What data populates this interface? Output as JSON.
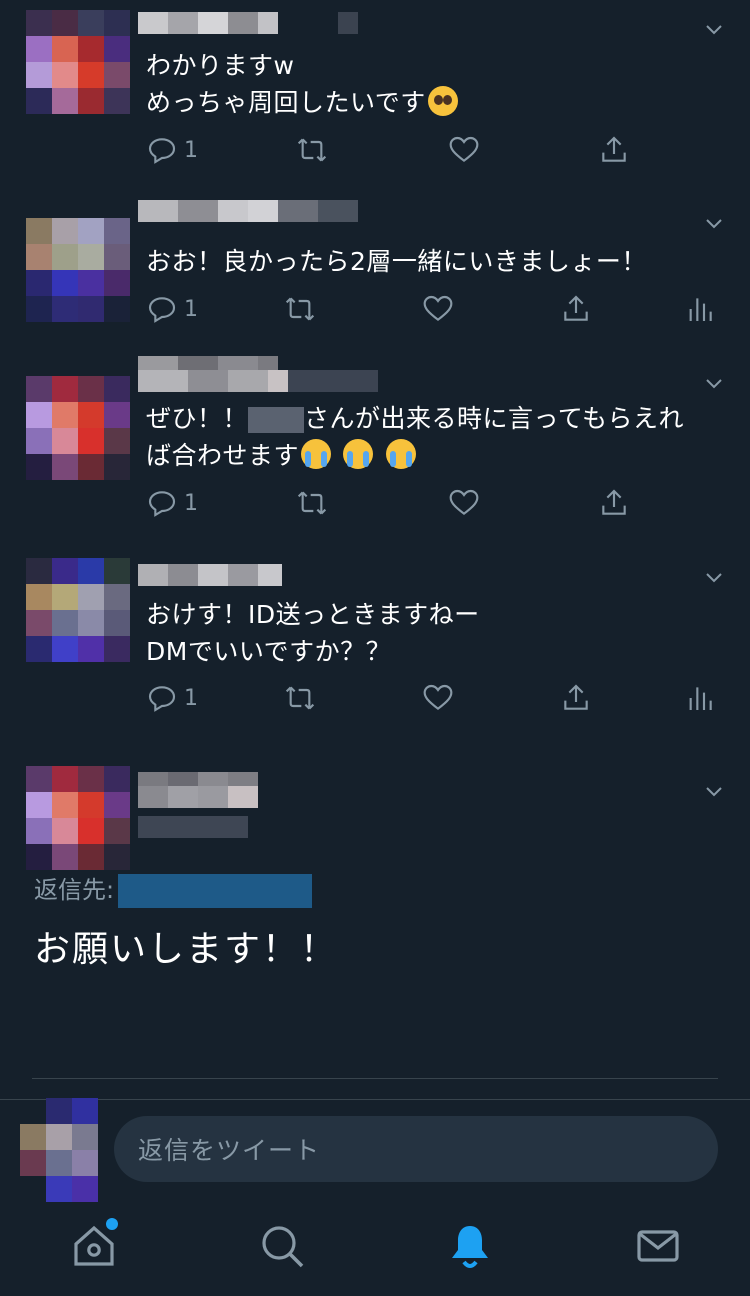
{
  "tweets": [
    {
      "lines": [
        "わかりますw",
        "めっちゃ周回したいです"
      ],
      "reply_count": "1",
      "show_analytics": false
    },
    {
      "lines": [
        "おお！良かったら2層一緒にいきましょー！"
      ],
      "reply_count": "1",
      "show_analytics": true
    },
    {
      "line1_prefix": "ぜひ！！",
      "line1_suffix": "さんが出来る時に言ってもらえれ",
      "line2": "ば合わせます",
      "reply_count": "1",
      "show_analytics": false
    },
    {
      "lines": [
        "おけす！ID送っときますねー",
        "DMでいいですか？？"
      ],
      "reply_count": "1",
      "show_analytics": true
    }
  ],
  "focused": {
    "reply_to_label": "返信先:",
    "text": "お願いします！！"
  },
  "composer": {
    "placeholder": "返信をツイート"
  },
  "nav": {
    "items": [
      "home",
      "search",
      "notifications",
      "messages"
    ],
    "active": "notifications"
  },
  "colors": {
    "background": "#15202b",
    "accent": "#1da1f2",
    "muted": "#8899a6"
  },
  "icons": [
    "reply-icon",
    "retweet-icon",
    "like-icon",
    "share-icon",
    "analytics-icon",
    "chevron-down-icon",
    "home-icon",
    "search-icon",
    "bell-icon",
    "mail-icon"
  ]
}
